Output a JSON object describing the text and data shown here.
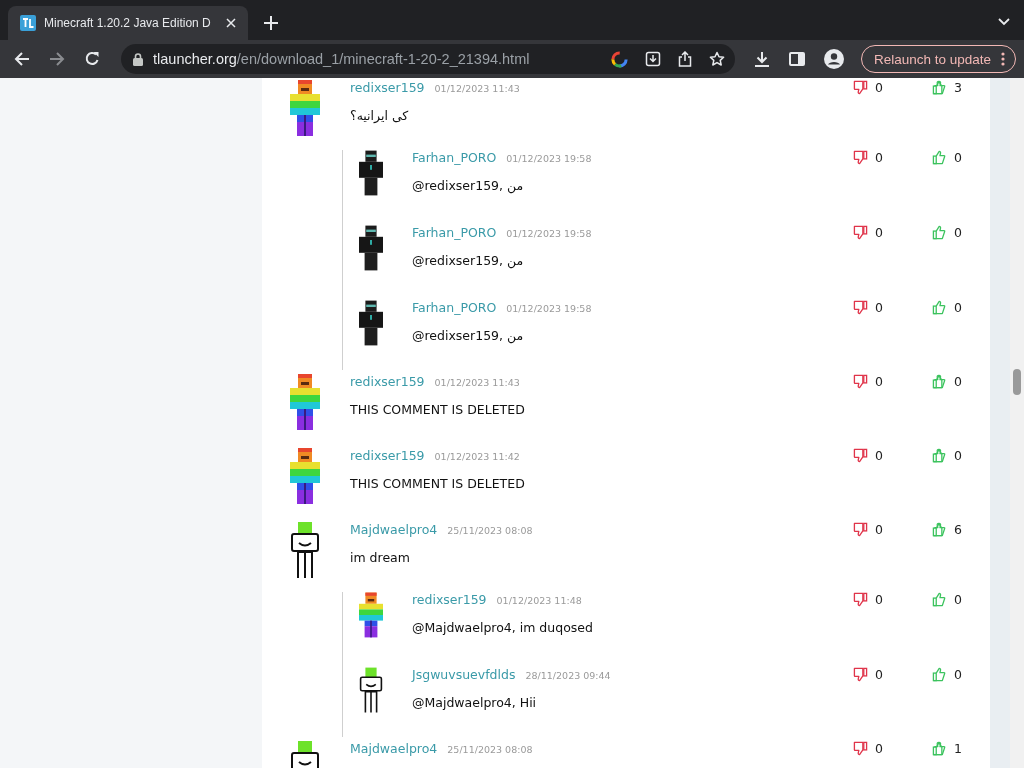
{
  "browser": {
    "tab": {
      "title": "Minecraft 1.20.2 Java Edition D",
      "selected": true
    },
    "url": {
      "host": "tlauncher.org",
      "path": "/en/download_1/minecraft-1-20-2_21394.html"
    },
    "relaunch_button": "Relaunch to update"
  },
  "comments": [
    {
      "kind": "rainbow",
      "author": "redixser159",
      "date": "01/12/2023 11:43",
      "text": "کی ایرانیه؟",
      "dislikes": "0",
      "likes": "3",
      "replies": [
        {
          "kind": "dark",
          "author": "Farhan_PORO",
          "date": "01/12/2023 19:58",
          "text": "@redixser159, من",
          "dislikes": "0",
          "likes": "0"
        },
        {
          "kind": "dark",
          "author": "Farhan_PORO",
          "date": "01/12/2023 19:58",
          "text": "@redixser159, من",
          "dislikes": "0",
          "likes": "0"
        },
        {
          "kind": "dark",
          "author": "Farhan_PORO",
          "date": "01/12/2023 19:58",
          "text": "@redixser159, من",
          "dislikes": "0",
          "likes": "0"
        }
      ]
    },
    {
      "kind": "rainbow",
      "author": "redixser159",
      "date": "01/12/2023 11:43",
      "text": "THIS COMMENT IS DELETED",
      "dislikes": "0",
      "likes": "0"
    },
    {
      "kind": "rainbow",
      "author": "redixser159",
      "date": "01/12/2023 11:42",
      "text": "THIS COMMENT IS DELETED",
      "dislikes": "0",
      "likes": "0"
    },
    {
      "kind": "dream",
      "author": "Majdwaelpro4",
      "date": "25/11/2023 08:08",
      "text": "im dream",
      "dislikes": "0",
      "likes": "6",
      "replies": [
        {
          "kind": "rainbow",
          "author": "redixser159",
          "date": "01/12/2023 11:48",
          "text": "@Majdwaelpro4, im duqosed",
          "dislikes": "0",
          "likes": "0"
        },
        {
          "kind": "dream",
          "author": "Jsgwuvsuevfdlds",
          "date": "28/11/2023 09:44",
          "text": "@Majdwaelpro4, Hii",
          "dislikes": "0",
          "likes": "0"
        }
      ]
    },
    {
      "kind": "dream",
      "author": "Majdwaelpro4",
      "date": "25/11/2023 08:08",
      "dislikes": "0",
      "likes": "1"
    }
  ]
}
